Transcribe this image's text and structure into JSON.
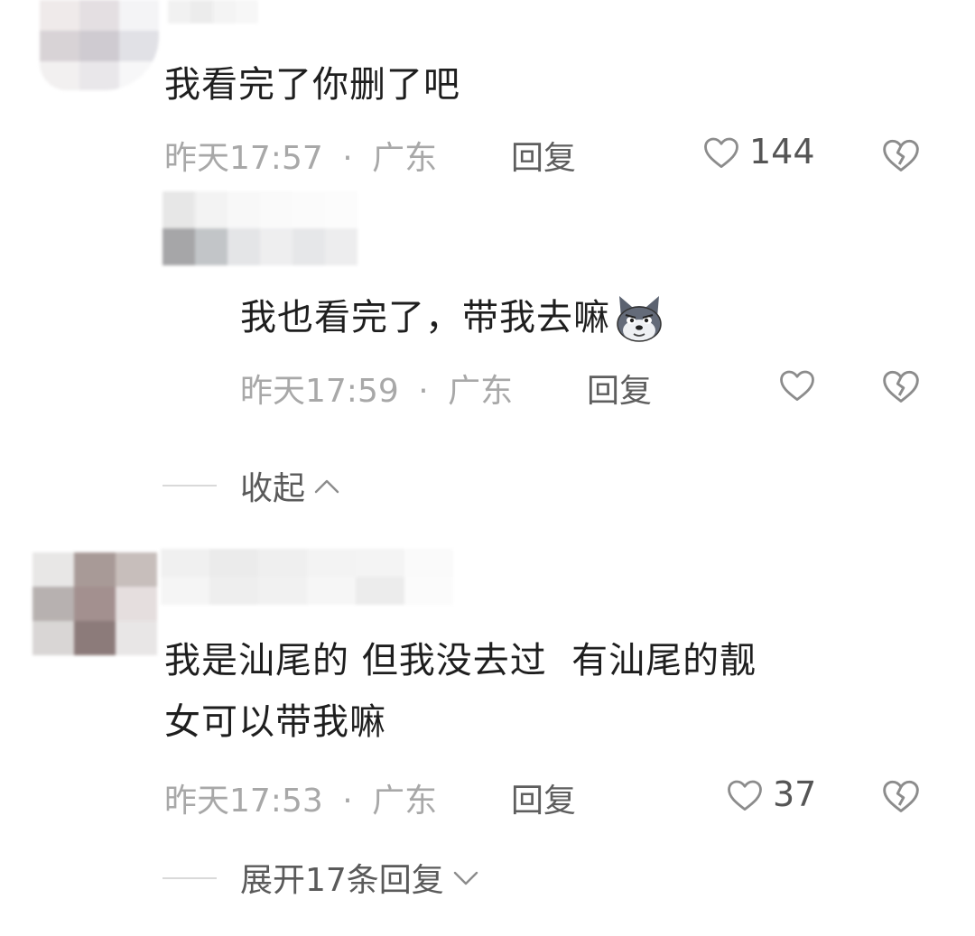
{
  "comments": [
    {
      "text": "我看完了你删了吧",
      "time": "昨天17:57",
      "location": "广东",
      "reply_label": "回复",
      "likes": "144",
      "replies": [
        {
          "text": "我也看完了，带我去嘛",
          "emoji": "wolf-face-emoji",
          "time": "昨天17:59",
          "location": "广东",
          "reply_label": "回复"
        }
      ],
      "toggle_label": "收起"
    },
    {
      "text_line1": "我是汕尾的 但我没去过  有汕尾的靓",
      "text_line2": "女可以带我嘛",
      "time": "昨天17:53",
      "location": "广东",
      "reply_label": "回复",
      "likes": "37",
      "toggle_label": "展开17条回复"
    }
  ],
  "separator": "·",
  "icons": {
    "like": "heart-outline-icon",
    "dislike": "broken-heart-icon",
    "collapse": "chevron-up-icon",
    "expand": "chevron-down-icon"
  },
  "colors": {
    "text": "#1e1e1e",
    "meta": "#a8a8a8",
    "action": "#5e5e5e",
    "icon": "#8c8c8c"
  }
}
